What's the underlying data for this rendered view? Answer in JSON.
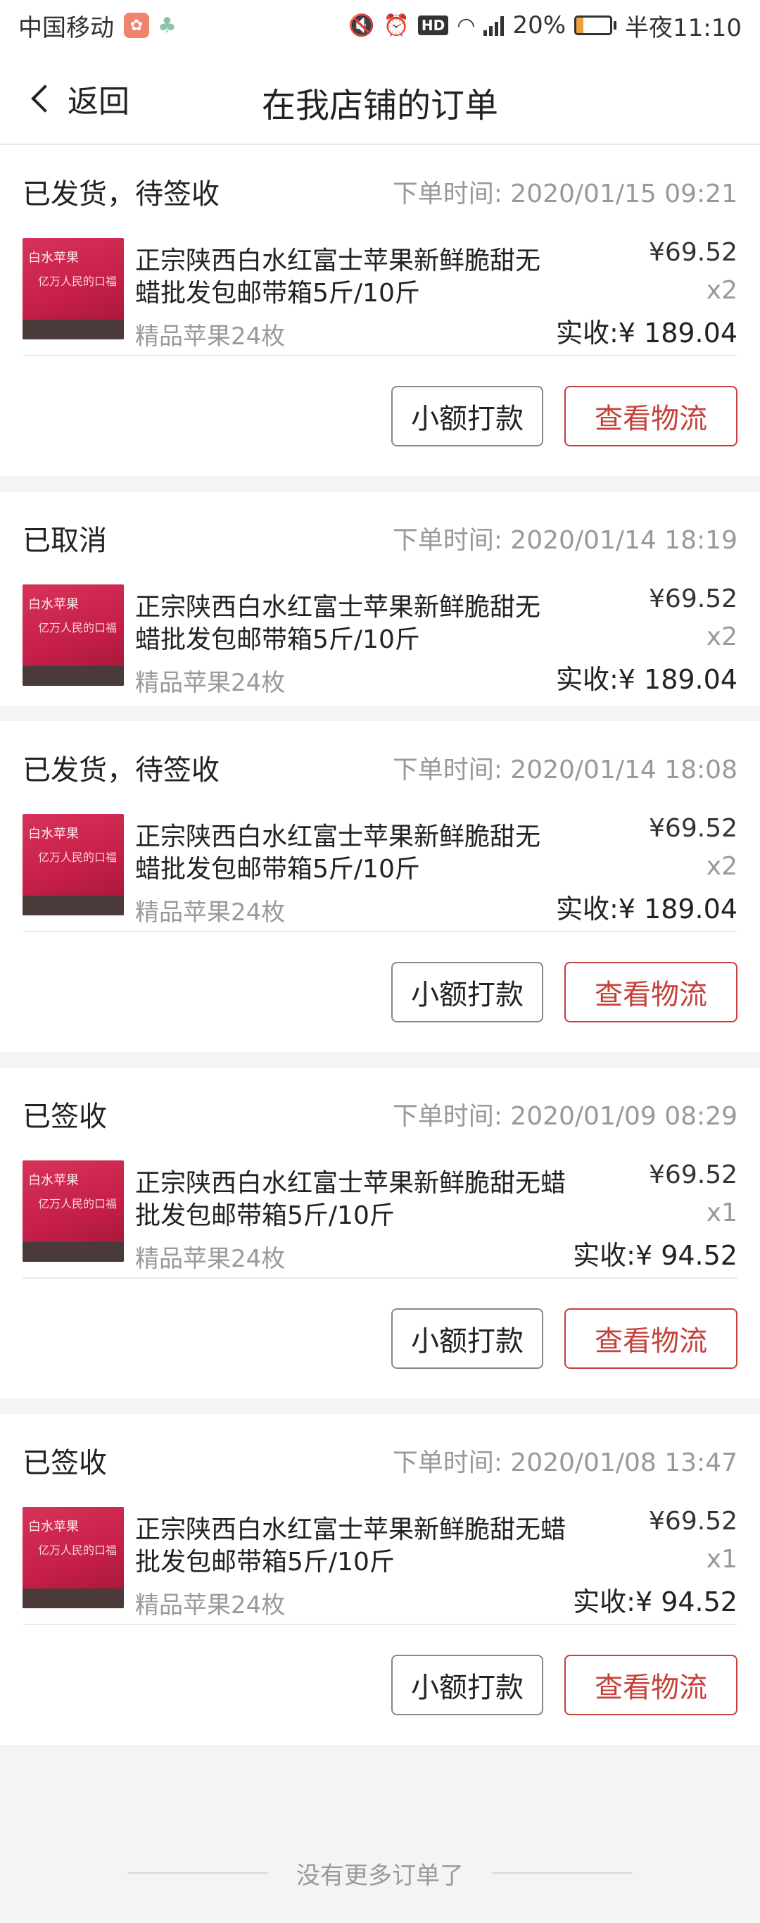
{
  "statusbar": {
    "carrier": "中国移动",
    "battery_pct": "20%",
    "battery_level": 0.2,
    "network": "4G",
    "hd": "HD",
    "time": "半夜11:10"
  },
  "navbar": {
    "back_label": "返回",
    "title": "在我店铺的订单"
  },
  "orders": [
    {
      "status": "已发货，待签收",
      "time": "下单时间: 2020/01/15 09:21",
      "name": "正宗陕西白水红富士苹果新鲜脆甜无蜡批发包邮带箱5斤/10斤",
      "sku": "精品苹果24枚",
      "price": "¥69.52",
      "qty": "x2",
      "total": "实收:¥ 189.04",
      "btn_transfer": "小额打款",
      "btn_logistics": "查看物流"
    },
    {
      "status": "已取消",
      "time": "下单时间: 2020/01/14 18:19",
      "name": "正宗陕西白水红富士苹果新鲜脆甜无蜡批发包邮带箱5斤/10斤",
      "sku": "精品苹果24枚",
      "price": "¥69.52",
      "qty": "x2",
      "total": "实收:¥ 189.04"
    },
    {
      "status": "已发货，待签收",
      "time": "下单时间: 2020/01/14 18:08",
      "name": "正宗陕西白水红富士苹果新鲜脆甜无蜡批发包邮带箱5斤/10斤",
      "sku": "精品苹果24枚",
      "price": "¥69.52",
      "qty": "x2",
      "total": "实收:¥ 189.04",
      "btn_transfer": "小额打款",
      "btn_logistics": "查看物流"
    },
    {
      "status": "已签收",
      "time": "下单时间: 2020/01/09 08:29",
      "name": "正宗陕西白水红富士苹果新鲜脆甜无蜡批发包邮带箱5斤/10斤",
      "sku": "精品苹果24枚",
      "price": "¥69.52",
      "qty": "x1",
      "total": "实收:¥ 94.52",
      "btn_transfer": "小额打款",
      "btn_logistics": "查看物流"
    },
    {
      "status": "已签收",
      "time": "下单时间: 2020/01/08 13:47",
      "name": "正宗陕西白水红富士苹果新鲜脆甜无蜡批发包邮带箱5斤/10斤",
      "sku": "精品苹果24枚",
      "price": "¥69.52",
      "qty": "x1",
      "total": "实收:¥ 94.52",
      "btn_transfer": "小额打款",
      "btn_logistics": "查看物流"
    }
  ],
  "footer": {
    "text": "没有更多订单了"
  }
}
